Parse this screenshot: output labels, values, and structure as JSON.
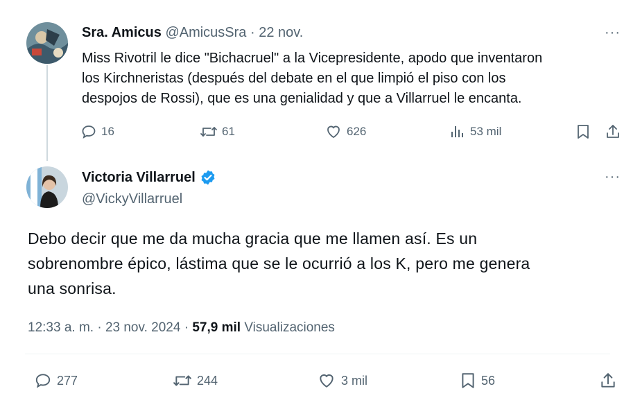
{
  "parent_tweet": {
    "display_name": "Sra. Amicus",
    "handle": "@AmicusSra",
    "separator": "·",
    "date": "22 nov.",
    "text_lines": [
      "Miss Rivotril le dice \"Bichacruel\" a la Vicepresidente, apodo que inventaron",
      "los Kirchneristas (después del debate en el que limpió el piso con los",
      "despojos de Rossi), que es una genialidad y que a Villarruel le encanta."
    ],
    "replies": "16",
    "reposts": "61",
    "likes": "626",
    "views": "53 mil"
  },
  "main_tweet": {
    "display_name": "Victoria Villarruel",
    "handle": "@VickyVillarruel",
    "verified": true,
    "text_lines": [
      "Debo decir que me da mucha gracia que me llamen así. Es un",
      "sobrenombre épico, lástima que se le ocurrió a los K, pero me genera",
      "una sonrisa."
    ],
    "time": "12:33 a. m.",
    "date": "23 nov. 2024",
    "views_count": "57,9 mil",
    "views_label": "Visualizaciones",
    "replies": "277",
    "reposts": "244",
    "likes": "3 mil",
    "bookmarks": "56"
  },
  "more_label": "···",
  "colors": {
    "text": "#0f1419",
    "muted": "#536471",
    "verified": "#1d9bf0",
    "thread_line": "#cfd9de"
  },
  "icons": [
    "reply-icon",
    "repost-icon",
    "like-icon",
    "views-icon",
    "bookmark-icon",
    "share-icon",
    "verified-badge-icon",
    "more-icon"
  ]
}
